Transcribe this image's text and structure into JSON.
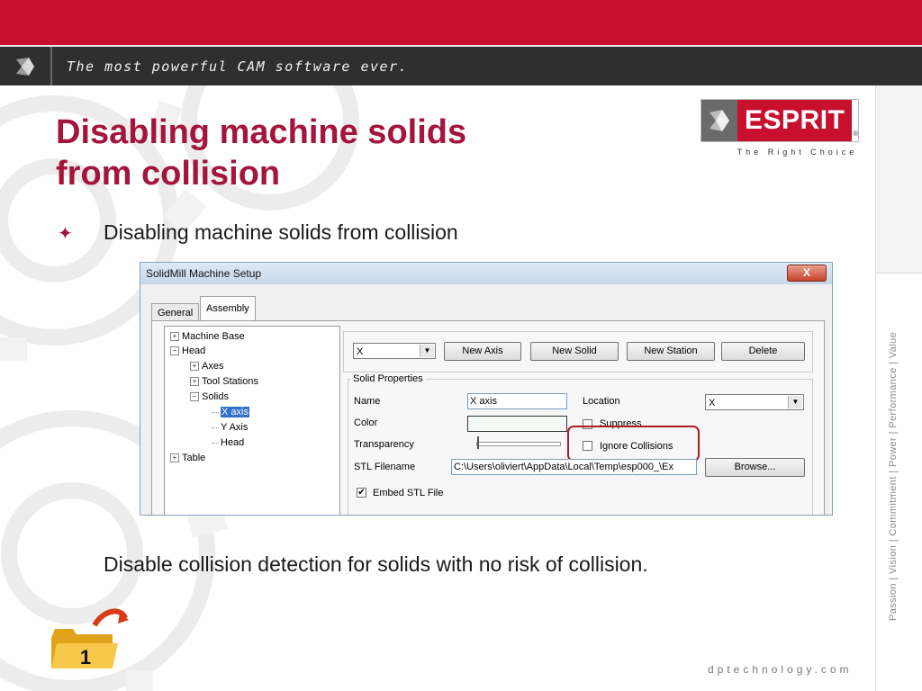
{
  "header": {
    "tagline": "The most powerful CAM software ever."
  },
  "slide": {
    "title_line1": "Disabling machine solids",
    "title_line2": "from collision",
    "bullet_symbol": "✦",
    "bullet_text": "Disabling machine solids from collision",
    "caption": "Disable collision detection for solids with no risk of collision."
  },
  "logo": {
    "brand": "ESPRIT",
    "registered": "®",
    "slogan": "The Right Choice"
  },
  "sidebar": {
    "vertical_text": "Passion | Vision | Commitment | Power | Performance | Value"
  },
  "footer": {
    "url": "dptechnology.com",
    "folder_number": "1"
  },
  "dialog": {
    "title": "SolidMill Machine Setup",
    "close_label": "X",
    "tabs": [
      "General",
      "Assembly"
    ],
    "active_tab": "Assembly",
    "tree": {
      "machine_base": "Machine Base",
      "head": "Head",
      "axes": "Axes",
      "tool_stations": "Tool Stations",
      "solids": "Solids",
      "x_axis": "X axis",
      "y_axis": "Y Axis",
      "head_child": "Head",
      "table": "Table"
    },
    "solid_select": "X",
    "buttons": {
      "new_axis": "New Axis",
      "new_solid": "New Solid",
      "new_station": "New Station",
      "delete": "Delete",
      "browse": "Browse..."
    },
    "solid_properties": {
      "group_label": "Solid Properties",
      "name_label": "Name",
      "name_value": "X axis",
      "location_label": "Location",
      "location_value": "X",
      "color_label": "Color",
      "suppress_label": "Suppress",
      "suppress_checked": false,
      "transparency_label": "Transparency",
      "ignore_collisions_label": "Ignore Collisions",
      "ignore_collisions_checked": false,
      "stl_filename_label": "STL Filename",
      "stl_filename_value": "C:\\Users\\oliviert\\AppData\\Local\\Temp\\esp000_\\Ex",
      "embed_stl_label": "Embed STL File",
      "embed_stl_checked": true,
      "color_swatch": "#f4fbf6"
    }
  },
  "colors": {
    "brand_red": "#c8102e",
    "title_red": "#a4153c",
    "highlight": "#b01a24"
  }
}
